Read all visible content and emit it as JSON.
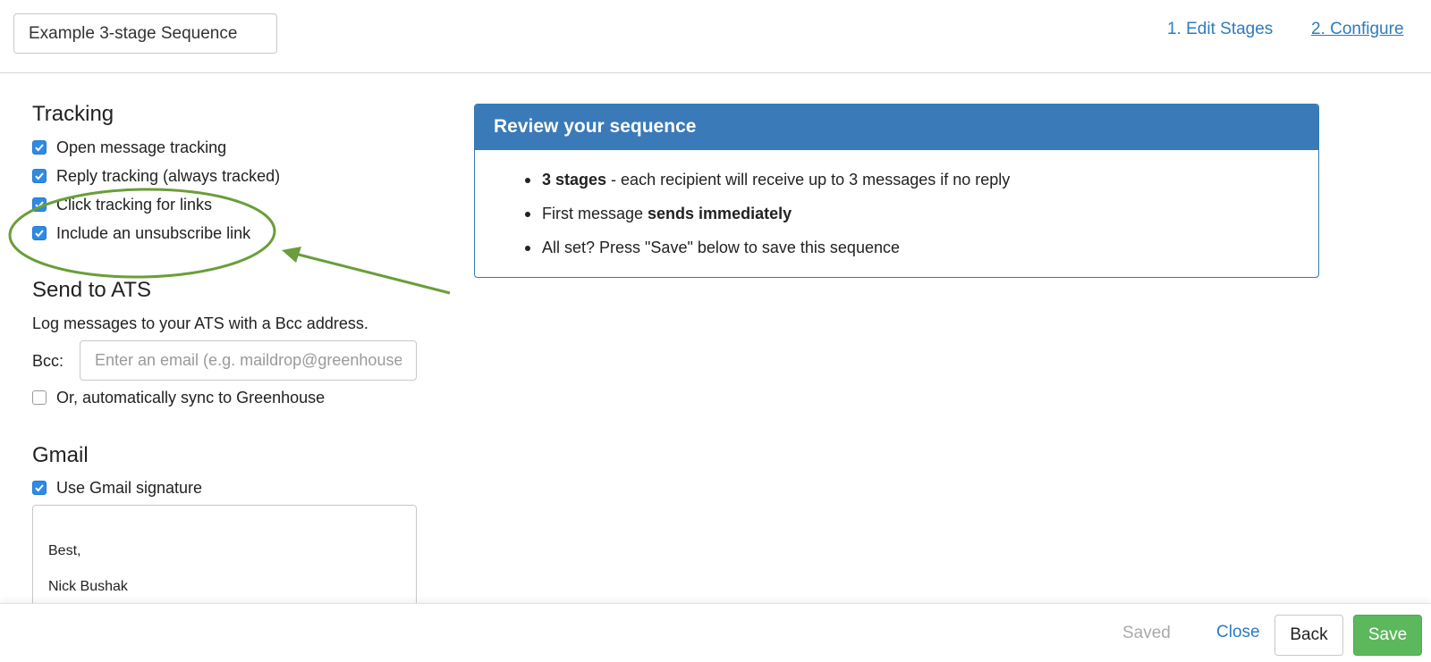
{
  "header": {
    "sequence_name": "Example 3-stage Sequence",
    "steps": [
      {
        "label": "1. Edit Stages"
      },
      {
        "label": "2. Configure"
      }
    ]
  },
  "tracking": {
    "title": "Tracking",
    "options": [
      {
        "label": "Open message tracking",
        "checked": true
      },
      {
        "label": "Reply tracking (always tracked)",
        "checked": true
      },
      {
        "label": "Click tracking for links",
        "checked": true
      },
      {
        "label": "Include an unsubscribe link",
        "checked": true
      }
    ]
  },
  "ats": {
    "title": "Send to ATS",
    "description": "Log messages to your ATS with a Bcc address.",
    "bcc_label": "Bcc:",
    "bcc_placeholder": "Enter an email (e.g. maildrop@greenhouse.io)",
    "sync_label": "Or, automatically sync to Greenhouse",
    "sync_checked": false
  },
  "gmail": {
    "title": "Gmail",
    "signature_label": "Use Gmail signature",
    "signature_checked": true,
    "signature_lines": [
      "Best,",
      "Nick Bushak"
    ]
  },
  "review": {
    "title": "Review your sequence",
    "items": [
      {
        "bold": "3 stages",
        "rest": " - each recipient will receive up to 3 messages if no reply",
        "bold_first": true
      },
      {
        "plain": "First message ",
        "bold": "sends immediately",
        "bold_first": false
      },
      {
        "plain": "All set? Press \"Save\" below to save this sequence"
      }
    ]
  },
  "footer": {
    "status": "Saved",
    "close_label": "Close",
    "back_label": "Back",
    "save_label": "Save"
  },
  "colors": {
    "accent": "#3a7ab8",
    "link": "#2f7bbf",
    "checkbox": "#2f8ae5",
    "save_button": "#5cb85c",
    "annotation": "#6a9e3a"
  },
  "icons": {
    "checkbox_checked": "checkmark-icon"
  }
}
